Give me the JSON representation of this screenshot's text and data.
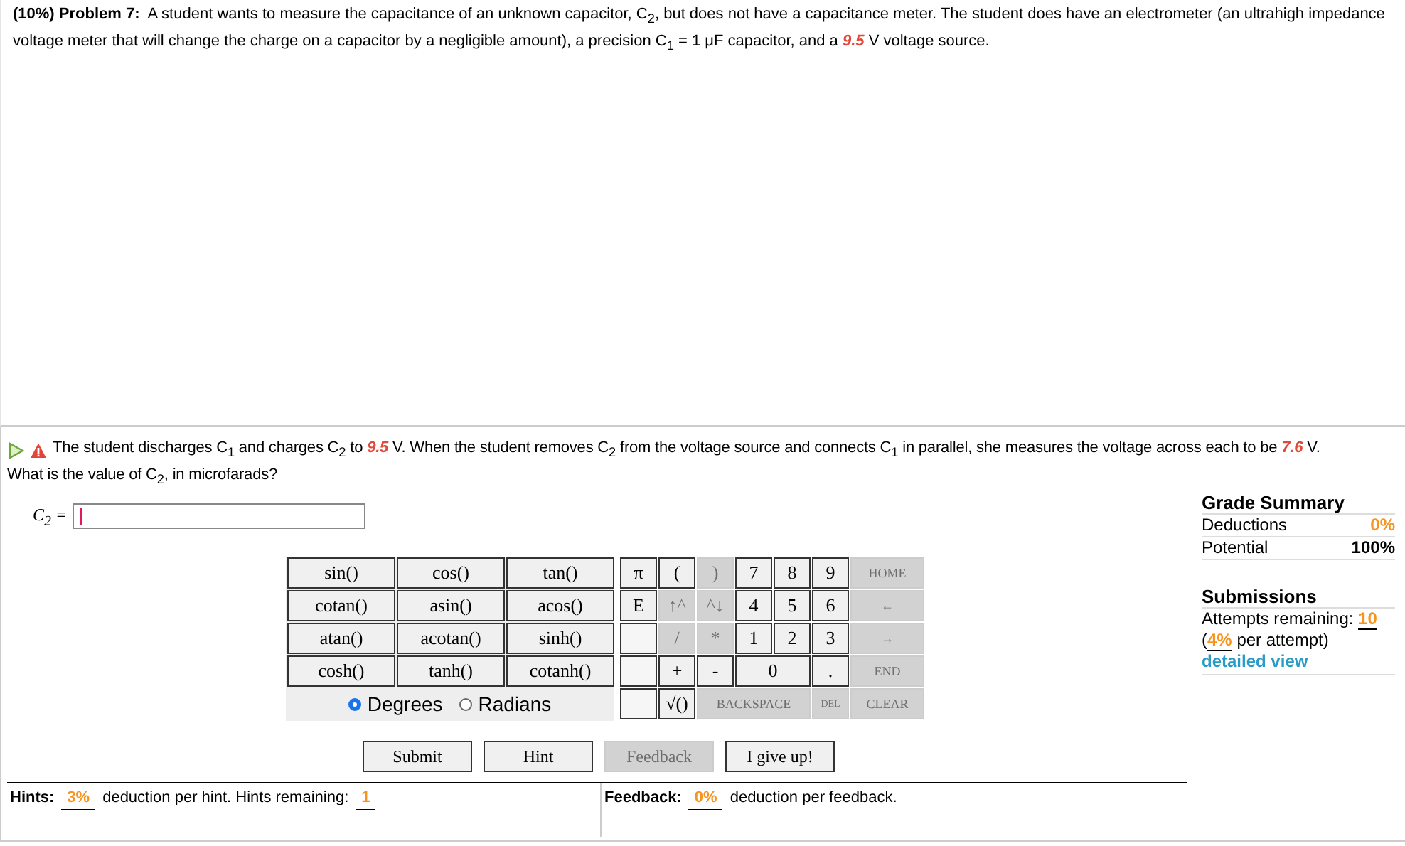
{
  "problem": {
    "percent": "(10%)",
    "label": "Problem 7:",
    "parts": [
      {
        "kind": "plain",
        "text": "A student wants to measure the capacitance of an unknown capacitor, C$_{2}$, but does not have a capacitance meter. The student does have an electrometer (an ultrahigh impedance voltage meter that will change the charge on a capacitor by a negligible amount), a precision C$_{1}$ = 1 μF capacitor, and a"
      },
      {
        "kind": "value",
        "text": "9.5"
      },
      {
        "kind": "plain",
        "text": "V voltage source."
      }
    ]
  },
  "question": {
    "parts": [
      {
        "kind": "plain",
        "text": "The student discharges C$_{1}$ and charges C$_{2}$ to"
      },
      {
        "kind": "value",
        "text": "9.5"
      },
      {
        "kind": "plain",
        "text": "V. When the student removes C$_{2}$ from the voltage source and connects C$_{1}$ in parallel, she measures the voltage across each to be"
      },
      {
        "kind": "value",
        "text": "7.6"
      },
      {
        "kind": "plain",
        "text": "V."
      }
    ],
    "line2": "What is the value of C$_{2}$, in microfarads?"
  },
  "answer": {
    "label": "C$_{2}$ ="
  },
  "functions": [
    [
      "sin()",
      "cos()",
      "tan()"
    ],
    [
      "cotan()",
      "asin()",
      "acos()"
    ],
    [
      "atan()",
      "acotan()",
      "sinh()"
    ],
    [
      "cosh()",
      "tanh()",
      "cotanh()"
    ]
  ],
  "angle_modes": [
    {
      "label": "Degrees",
      "selected": true
    },
    {
      "label": "Radians",
      "selected": false
    }
  ],
  "keypad": [
    [
      {
        "kind": "key",
        "label": "π",
        "disabled": false
      },
      {
        "kind": "key",
        "label": "(",
        "disabled": false
      },
      {
        "kind": "key",
        "label": ")",
        "disabled": true
      },
      {
        "kind": "key",
        "label": "7",
        "disabled": false
      },
      {
        "kind": "key",
        "label": "8",
        "disabled": false
      },
      {
        "kind": "key",
        "label": "9",
        "disabled": false
      },
      {
        "kind": "small",
        "label": "HOME",
        "disabled": true
      }
    ],
    [
      {
        "kind": "key",
        "label": "E",
        "disabled": false
      },
      {
        "kind": "key",
        "label": "↑^",
        "disabled": true
      },
      {
        "kind": "key",
        "label": "^↓",
        "disabled": true
      },
      {
        "kind": "key",
        "label": "4",
        "disabled": false
      },
      {
        "kind": "key",
        "label": "5",
        "disabled": false
      },
      {
        "kind": "key",
        "label": "6",
        "disabled": false
      },
      {
        "kind": "small",
        "label": "←",
        "disabled": true
      }
    ],
    [
      {
        "kind": "blank"
      },
      {
        "kind": "key",
        "label": "/",
        "disabled": true
      },
      {
        "kind": "key",
        "label": "*",
        "disabled": true
      },
      {
        "kind": "key",
        "label": "1",
        "disabled": false
      },
      {
        "kind": "key",
        "label": "2",
        "disabled": false
      },
      {
        "kind": "key",
        "label": "3",
        "disabled": false
      },
      {
        "kind": "small",
        "label": "→",
        "disabled": true
      }
    ],
    [
      {
        "kind": "blank"
      },
      {
        "kind": "key",
        "label": "+",
        "disabled": false
      },
      {
        "kind": "key",
        "label": "-",
        "disabled": false
      },
      {
        "kind": "double",
        "label": "0",
        "disabled": false
      },
      {
        "kind": "key",
        "label": ".",
        "disabled": false
      },
      {
        "kind": "small",
        "label": "END",
        "disabled": true
      }
    ],
    [
      {
        "kind": "blank"
      },
      {
        "kind": "key",
        "label": "√()",
        "disabled": false
      },
      {
        "kind": "triple",
        "label": "BACKSPACE",
        "disabled": true
      },
      {
        "kind": "tiny",
        "label": "DEL",
        "disabled": true
      },
      {
        "kind": "small",
        "label": "CLEAR",
        "disabled": true
      }
    ]
  ],
  "buttons": [
    {
      "label": "Submit",
      "disabled": false
    },
    {
      "label": "Hint",
      "disabled": false
    },
    {
      "label": "Feedback",
      "disabled": true
    },
    {
      "label": "I give up!",
      "disabled": false
    }
  ],
  "hints": {
    "label": "Hints:",
    "value": "3%",
    "text": "deduction per hint. Hints remaining:",
    "remaining": "1"
  },
  "feedback": {
    "label": "Feedback:",
    "value": "0%",
    "text": "deduction per feedback."
  },
  "grade_summary": {
    "title": "Grade Summary",
    "rows": [
      {
        "kind": "deduction",
        "label": "Deductions",
        "value": "0%"
      },
      {
        "kind": "potential",
        "label": "Potential",
        "value": "100%"
      }
    ]
  },
  "submissions": {
    "title": "Submissions",
    "attempts_label": "Attempts remaining:",
    "attempts": "10",
    "open": "(",
    "per_attempt": "4%",
    "per_attempt_text": "per attempt)",
    "link": "detailed view"
  }
}
